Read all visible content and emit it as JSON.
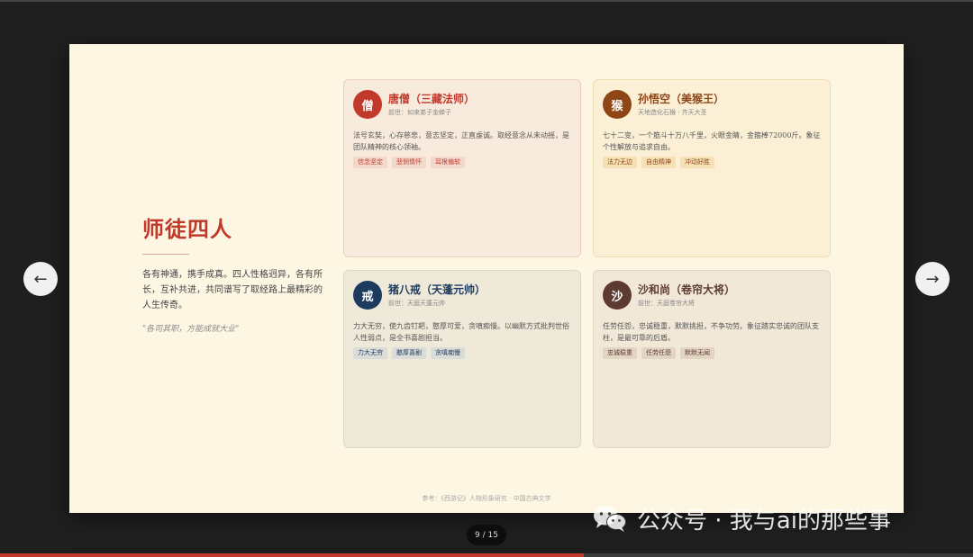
{
  "slide": {
    "title": "师徒四人",
    "intro": "各有神通，携手成真。四人性格迥异，各有所长，互补共进，共同谱写了取经路上最精彩的人生传奇。",
    "quote": "\"各司其职，方能成就大业\"",
    "footer": "参考：《西游记》人物形象研究 · 中国古典文学"
  },
  "characters": [
    {
      "avatar": "僧",
      "name": "唐僧（三藏法师）",
      "sub": "前世：如来弟子金蝉子",
      "desc": "法号玄奘，心存慈悲，意志坚定，正直虔诚。取经意念从未动摇，是团队精神的核心领袖。",
      "tags": [
        "信念坚定",
        "悲悯情怀",
        "耳根偏软"
      ],
      "color": "#c0392b"
    },
    {
      "avatar": "猴",
      "name": "孙悟空（美猴王）",
      "sub": "天地造化石猴 · 齐天大圣",
      "desc": "七十二变，一个筋斗十万八千里，火眼金睛，金箍棒72000斤。象征个性解放与追求自由。",
      "tags": [
        "法力无边",
        "自由精神",
        "冲动好胜"
      ],
      "color": "#8e4616"
    },
    {
      "avatar": "戒",
      "name": "猪八戒（天蓬元帅）",
      "sub": "前世：天庭天蓬元帅",
      "desc": "力大无穷，使九齿钉耙，憨厚可爱，贪嗔痴慢。以幽默方式批判世俗人性弱点，是全书喜剧担当。",
      "tags": [
        "力大无穷",
        "憨厚喜剧",
        "贪嗔痴慢"
      ],
      "color": "#1d3a5f"
    },
    {
      "avatar": "沙",
      "name": "沙和尚（卷帘大将）",
      "sub": "前世：天庭卷帘大将",
      "desc": "任劳任怨，忠诚稳重，默默挑担，不争功劳。象征踏实忠诚的团队支柱，是最可靠的后盾。",
      "tags": [
        "忠诚稳重",
        "任劳任怨",
        "默默无闻"
      ],
      "color": "#5d3b30"
    }
  ],
  "navigation": {
    "prev_icon": "←",
    "next_icon": "→",
    "page_indicator": "9 / 15",
    "progress": 0.6
  },
  "watermark": {
    "text": "公众号 · 我与ai的那些事",
    "icon": "wechat-icon"
  }
}
